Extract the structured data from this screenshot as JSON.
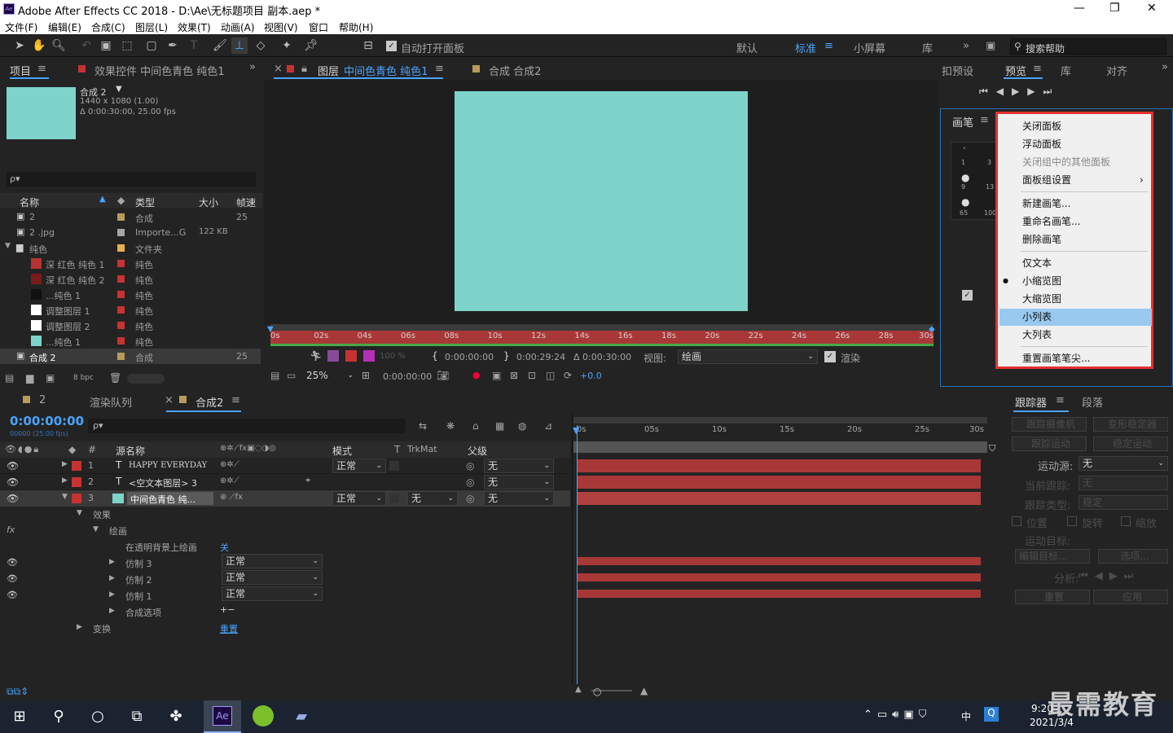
{
  "title": {
    "app": "Adobe After Effects CC 2018 - D:\\Ae\\无标题项目 副本.aep *"
  },
  "menu": [
    "文件(F)",
    "编辑(E)",
    "合成(C)",
    "图层(L)",
    "效果(T)",
    "动画(A)",
    "视图(V)",
    "窗口",
    "帮助(H)"
  ],
  "toolbar": {
    "auto_open": "自动打开面板",
    "workspaces": [
      "默认",
      "标准",
      "小屏幕",
      "库"
    ],
    "search_help": "搜索帮助"
  },
  "project": {
    "tab_project": "项目",
    "tab_effects": "效果控件 中间色青色 纯色1",
    "comp_name": "合成 2",
    "comp_info1": "1440 x 1080 (1.00)",
    "comp_info2": "Δ 0:00:30:00, 25.00 fps",
    "search_placeholder": "ρ▾",
    "headers": {
      "name": "名称",
      "type": "类型",
      "size": "大小",
      "fps": "帧速"
    },
    "items": [
      {
        "name": "2",
        "type": "合成",
        "size": "",
        "fps": "25",
        "color": "#b89b5c"
      },
      {
        "name": "2 .jpg",
        "type": "Importe...G",
        "size": "122 KB",
        "fps": "",
        "color": "#a5a5a5"
      },
      {
        "name": "纯色",
        "type": "文件夹",
        "size": "",
        "fps": "",
        "color": "#e6b44a"
      },
      {
        "name": "深 红色 纯色 1",
        "type": "纯色",
        "size": "",
        "fps": "",
        "color": "#c83232",
        "swatch": "#b83232"
      },
      {
        "name": "深 红色 纯色 2",
        "type": "纯色",
        "size": "",
        "fps": "",
        "color": "#c83232",
        "swatch": "#7a1a1a"
      },
      {
        "name": "...纯色 1",
        "type": "纯色",
        "size": "",
        "fps": "",
        "color": "#c83232",
        "swatch": "#111111"
      },
      {
        "name": "调整图层 1",
        "type": "纯色",
        "size": "",
        "fps": "",
        "color": "#c83232",
        "swatch": "#ffffff"
      },
      {
        "name": "调整图层 2",
        "type": "纯色",
        "size": "",
        "fps": "",
        "color": "#c83232",
        "swatch": "#ffffff"
      },
      {
        "name": "...纯色 1",
        "type": "纯色",
        "size": "",
        "fps": "",
        "color": "#c83232",
        "swatch": "#7ed3cb"
      },
      {
        "name": "合成 2",
        "type": "合成",
        "size": "",
        "fps": "25",
        "color": "#b89b5c"
      }
    ],
    "bpc": "8 bpc"
  },
  "viewer": {
    "tab_layer": "图层",
    "layer_name": "中间色青色 纯色1",
    "tab_comp": "合成 合成2",
    "canvas_color": "#7ed3cb",
    "ruler": [
      "0s",
      "02s",
      "04s",
      "06s",
      "08s",
      "10s",
      "12s",
      "14s",
      "16s",
      "18s",
      "20s",
      "22s",
      "24s",
      "26s",
      "28s",
      "30s"
    ],
    "opacity": "100 %",
    "time_start": "0:00:00:00",
    "time_end": "0:00:29:24",
    "duration": "Δ 0:00:30:00",
    "view_label": "视图:",
    "view_value": "绘画",
    "render": "渲染",
    "zoom": "25%",
    "current_time": "0:00:00:00",
    "exposure": "+0.0"
  },
  "right": {
    "tab_preset": "扣预设",
    "tab_preview": "预览",
    "tab_lib": "库",
    "tab_align": "对齐",
    "tab_brush": "画笔",
    "brush_sizes": [
      "1",
      "3",
      "9",
      "13",
      "65",
      "100"
    ]
  },
  "context_menu": {
    "items": [
      {
        "label": "关闭面板",
        "disabled": false
      },
      {
        "label": "浮动面板",
        "disabled": false
      },
      {
        "label": "关闭组中的其他面板",
        "disabled": true
      },
      {
        "label": "面板组设置",
        "disabled": false,
        "arrow": "›"
      },
      {
        "label": "新建画笔...",
        "disabled": false
      },
      {
        "label": "重命名画笔...",
        "disabled": false
      },
      {
        "label": "删除画笔",
        "disabled": false
      },
      {
        "label": "仅文本",
        "disabled": false
      },
      {
        "label": "小缩览图",
        "disabled": false,
        "checked": "●"
      },
      {
        "label": "大缩览图",
        "disabled": false
      },
      {
        "label": "小列表",
        "disabled": false,
        "highlight": true
      },
      {
        "label": "大列表",
        "disabled": false
      },
      {
        "label": "重置画笔笔尖...",
        "disabled": false
      }
    ]
  },
  "timeline": {
    "tab_2": "2",
    "tab_render": "渲染队列",
    "tab_comp": "合成2",
    "time": "0:00:00:00",
    "time_sub": "00000 (25.00 fps)",
    "col_source": "源名称",
    "col_mode": "模式",
    "col_t": "T",
    "col_trkmat": "TrkMat",
    "col_parent": "父级",
    "ruler": [
      "0s",
      "05s",
      "10s",
      "15s",
      "20s",
      "25s",
      "30s"
    ],
    "layers": [
      {
        "num": "1",
        "type": "T",
        "name": "HAPPY EVERYDAY",
        "mode": "正常",
        "parent": "无"
      },
      {
        "num": "2",
        "type": "T",
        "name": "<空文本图层> 3",
        "mode": "",
        "parent": "无"
      },
      {
        "num": "3",
        "type": "",
        "name": "中间色青色 纯...",
        "mode": "正常",
        "trkmat": "无",
        "parent": "无"
      }
    ],
    "props": {
      "effects": "效果",
      "paint": "绘画",
      "on_transparent": "在透明背景上绘画",
      "on_transparent_val": "关",
      "clone3": "仿制 3",
      "clone2": "仿制 2",
      "clone1": "仿制 1",
      "blend": "正常",
      "composite": "合成选项",
      "transform": "变换",
      "reset": "重置"
    }
  },
  "tracker": {
    "tab_tracker": "跟踪器",
    "tab_para": "段落",
    "track_camera": "跟踪摄像机",
    "warp_stab": "变形稳定器",
    "track_motion": "跟踪运动",
    "stab_motion": "稳定运动",
    "source_label": "运动源:",
    "source_value": "无",
    "current_track": "当前跟踪:",
    "current_val": "无",
    "track_type": "跟踪类型:",
    "track_type_val": "稳定",
    "pos": "位置",
    "rot": "旋转",
    "scale": "缩放",
    "target": "运动目标:",
    "edit_target": "编辑目标...",
    "options": "选项...",
    "analyze": "分析:",
    "reset": "重置",
    "apply": "应用"
  },
  "taskbar": {
    "time": "9:20",
    "date": "2021/3/4",
    "ime": "中",
    "watermark": "最需教育"
  }
}
